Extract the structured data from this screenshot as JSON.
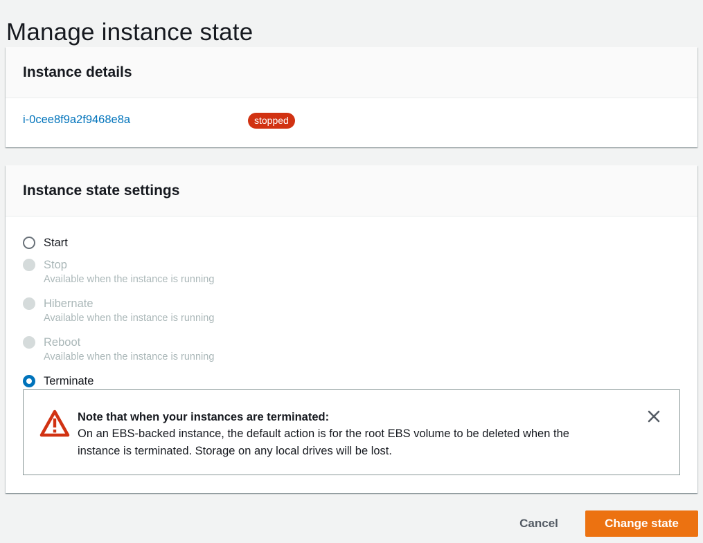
{
  "page": {
    "title": "Manage instance state"
  },
  "instance_details": {
    "heading": "Instance details",
    "instance_id": "i-0cee8f9a2f9468e8a",
    "status": "stopped",
    "status_color": "#d13212",
    "link_color": "#0073bb"
  },
  "state_settings": {
    "heading": "Instance state settings",
    "selected": "Terminate",
    "options": [
      {
        "label": "Start",
        "description": "",
        "disabled": false,
        "checked": false
      },
      {
        "label": "Stop",
        "description": "Available when the instance is running",
        "disabled": true,
        "checked": false
      },
      {
        "label": "Hibernate",
        "description": "Available when the instance is running",
        "disabled": true,
        "checked": false
      },
      {
        "label": "Reboot",
        "description": "Available when the instance is running",
        "disabled": true,
        "checked": false
      },
      {
        "label": "Terminate",
        "description": "",
        "disabled": false,
        "checked": true
      }
    ]
  },
  "alert": {
    "type": "warning",
    "icon": "warning-icon",
    "title": "Note that when your instances are terminated:",
    "line1": "On an EBS-backed instance, the default action is for the root EBS volume to be deleted when the",
    "line2": "instance is terminated. Storage on any local drives will be lost.",
    "icon_color": "#d13212"
  },
  "actions": {
    "cancel_label": "Cancel",
    "submit_label": "Change state",
    "submit_color": "#ec7211"
  }
}
